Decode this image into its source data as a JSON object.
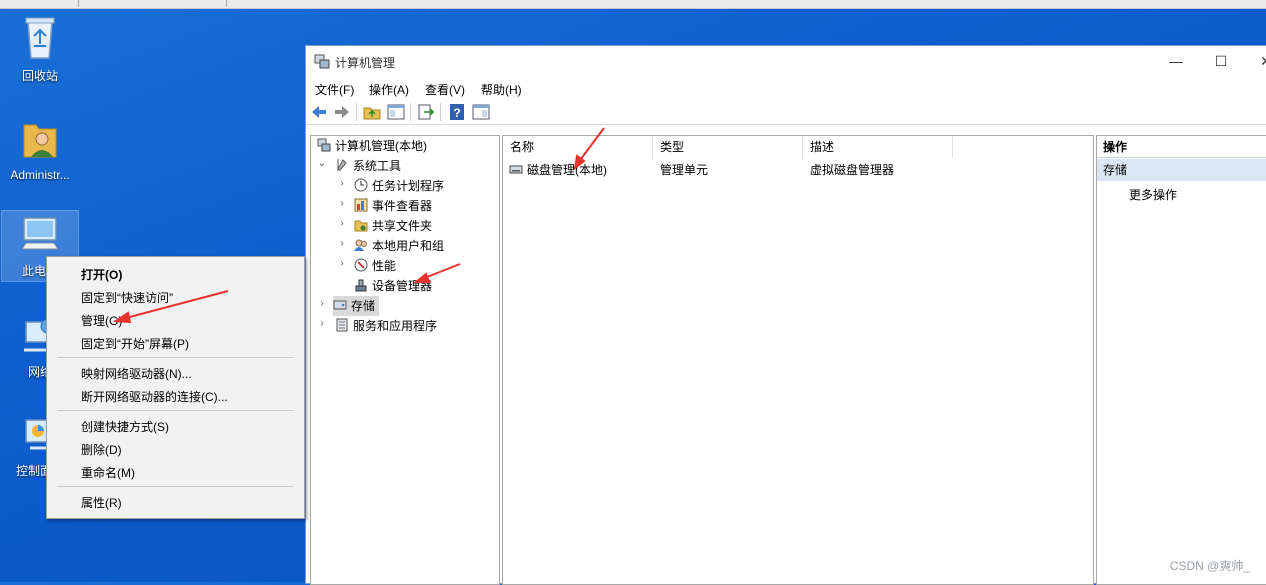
{
  "desktop": {
    "icons": [
      {
        "label": "回收站",
        "icon": "recycle-bin-icon"
      },
      {
        "label": "Administr...",
        "icon": "user-folder-icon"
      },
      {
        "label": "此电脑",
        "icon": "this-pc-icon"
      },
      {
        "label": "网络",
        "icon": "network-icon"
      },
      {
        "label": "控制面板",
        "icon": "control-panel-icon"
      }
    ]
  },
  "context_menu": {
    "items": [
      {
        "label": "打开(O)",
        "bold": true
      },
      {
        "label": "固定到“快速访问”"
      },
      {
        "label": "管理(G)"
      },
      {
        "label": "固定到“开始”屏幕(P)"
      },
      {
        "label": "映射网络驱动器(N)..."
      },
      {
        "label": "断开网络驱动器的连接(C)..."
      },
      {
        "label": "创建快捷方式(S)"
      },
      {
        "label": "删除(D)"
      },
      {
        "label": "重命名(M)"
      },
      {
        "label": "属性(R)"
      }
    ]
  },
  "window": {
    "title": "计算机管理",
    "controls": {
      "minimize": "—",
      "maximize": "☐",
      "close": "✕"
    },
    "menu": [
      "文件(F)",
      "操作(A)",
      "查看(V)",
      "帮助(H)"
    ],
    "tree": {
      "root": "计算机管理(本地)",
      "system_tools": "系统工具",
      "children": [
        "任务计划程序",
        "事件查看器",
        "共享文件夹",
        "本地用户和组",
        "性能",
        "设备管理器"
      ],
      "storage": "存储",
      "services": "服务和应用程序"
    },
    "list": {
      "columns": [
        "名称",
        "类型",
        "描述"
      ],
      "rows": [
        {
          "name": "磁盘管理(本地)",
          "type": "管理单元",
          "desc": "虚拟磁盘管理器"
        }
      ]
    },
    "actions": {
      "header": "操作",
      "section": "存储",
      "more": "更多操作"
    }
  },
  "watermark": "CSDN @爽帅_",
  "colors": {
    "desktop": "#0e5fcf",
    "selection": "#cce4f7",
    "arrow": "#e8322d"
  }
}
